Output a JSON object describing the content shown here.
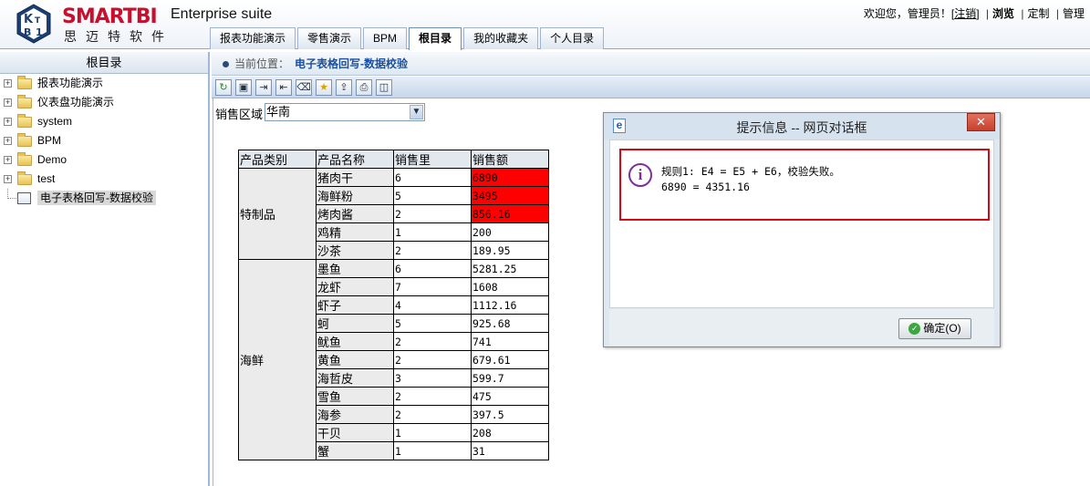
{
  "header": {
    "brand": "SMARTBI",
    "brand_cn": "思迈特软件",
    "suite": "Enterprise suite",
    "welcome": "欢迎您，管理员！[",
    "logout": "注销",
    "welcome_end": "]",
    "links": [
      "浏览",
      "定制",
      "管理"
    ]
  },
  "tabs": [
    {
      "label": "报表功能演示",
      "active": false
    },
    {
      "label": "零售演示",
      "active": false
    },
    {
      "label": "BPM",
      "active": false
    },
    {
      "label": "根目录",
      "active": true
    },
    {
      "label": "我的收藏夹",
      "active": false
    },
    {
      "label": "个人目录",
      "active": false
    }
  ],
  "sidebar": {
    "title": "根目录",
    "items": [
      {
        "label": "报表功能演示"
      },
      {
        "label": "仪表盘功能演示"
      },
      {
        "label": "system"
      },
      {
        "label": "BPM"
      },
      {
        "label": "Demo"
      },
      {
        "label": "test"
      }
    ],
    "selected_item": "电子表格回写-数据校验"
  },
  "breadcrumb": {
    "prefix": "当前位置：",
    "current": "电子表格回写-数据校验"
  },
  "toolbar_icons": [
    "refresh-icon",
    "save-icon",
    "insert-row-icon",
    "delete-row-icon",
    "eraser-icon",
    "star-icon",
    "export-icon",
    "print-icon",
    "preview-icon"
  ],
  "params": {
    "label": "销售区域",
    "value": "华南"
  },
  "table": {
    "headers": [
      "产品类别",
      "产品名称",
      "销售里",
      "销售额"
    ],
    "groups": [
      {
        "category": "特制品",
        "rows": [
          {
            "name": "猪肉干",
            "qty": "6",
            "amount": "6890",
            "error": true
          },
          {
            "name": "海鲜粉",
            "qty": "5",
            "amount": "3495",
            "error": true
          },
          {
            "name": "烤肉酱",
            "qty": "2",
            "amount": "856.16",
            "error": true
          },
          {
            "name": "鸡精",
            "qty": "1",
            "amount": "200",
            "error": false
          },
          {
            "name": "沙茶",
            "qty": "2",
            "amount": "189.95",
            "error": false
          }
        ]
      },
      {
        "category": "海鲜",
        "rows": [
          {
            "name": "墨鱼",
            "qty": "6",
            "amount": "5281.25",
            "error": false
          },
          {
            "name": "龙虾",
            "qty": "7",
            "amount": "1608",
            "error": false
          },
          {
            "name": "虾子",
            "qty": "4",
            "amount": "1112.16",
            "error": false
          },
          {
            "name": "蚵",
            "qty": "5",
            "amount": "925.68",
            "error": false
          },
          {
            "name": "鱿鱼",
            "qty": "2",
            "amount": "741",
            "error": false
          },
          {
            "name": "黄鱼",
            "qty": "2",
            "amount": "679.61",
            "error": false
          },
          {
            "name": "海哲皮",
            "qty": "3",
            "amount": "599.7",
            "error": false
          },
          {
            "name": "雪鱼",
            "qty": "2",
            "amount": "475",
            "error": false
          },
          {
            "name": "海参",
            "qty": "2",
            "amount": "397.5",
            "error": false
          },
          {
            "name": "干贝",
            "qty": "1",
            "amount": "208",
            "error": false
          },
          {
            "name": "蟹",
            "qty": "1",
            "amount": "31",
            "error": false
          }
        ]
      }
    ],
    "error_color": "#ff0000"
  },
  "dialog": {
    "title": "提示信息 -- 网页对话框",
    "message_line1": "规则1: E4 = E5 + E6，校验失败。",
    "message_line2": "6890 = 4351.16",
    "ok_label": "确定(O)",
    "close_label": "✕"
  }
}
